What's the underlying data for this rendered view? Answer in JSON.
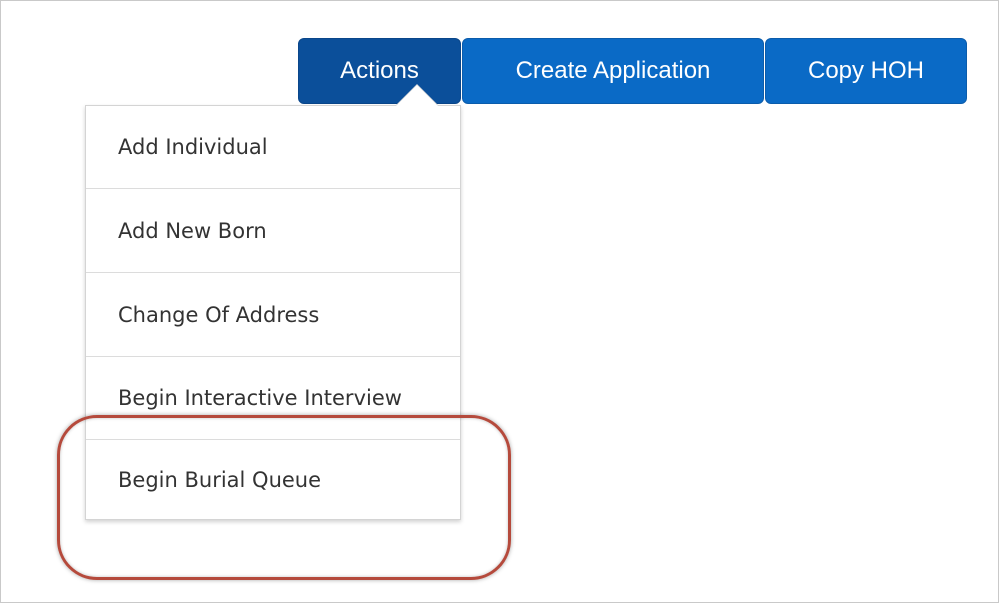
{
  "toolbar": {
    "actions_label": "Actions",
    "create_application_label": "Create Application",
    "copy_hoh_label": "Copy HOH"
  },
  "actions_menu": {
    "items": [
      {
        "label": "Add Individual"
      },
      {
        "label": "Add New Born"
      },
      {
        "label": "Change Of Address"
      },
      {
        "label": "Begin Interactive Interview"
      },
      {
        "label": "Begin Burial Queue"
      }
    ],
    "highlighted_item": "Begin Burial Queue"
  },
  "colors": {
    "button_primary": "#0a6ac6",
    "button_active": "#0b4f9a",
    "highlight_outline": "#b54a3c"
  }
}
